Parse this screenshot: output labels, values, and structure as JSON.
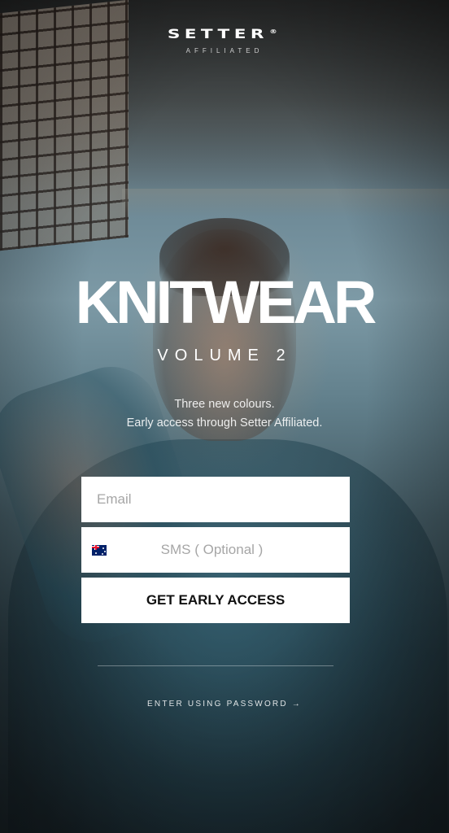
{
  "brand": {
    "name": "SETTER",
    "registered_mark": "®",
    "subtitle": "AFFILIATED"
  },
  "hero": {
    "headline": "KNITWEAR",
    "volume": "VOLUME 2",
    "description_line1": "Three new colours.",
    "description_line2": "Early access through Setter Affiliated."
  },
  "form": {
    "email_placeholder": "Email",
    "sms_placeholder": "SMS ( Optional )",
    "country_flag_icon": "australia-flag-icon",
    "submit_label": "GET EARLY ACCESS"
  },
  "footer": {
    "password_link": "ENTER USING PASSWORD →"
  },
  "colors": {
    "input_background": "#ffffff",
    "button_text": "#111111",
    "placeholder_text": "#a6a6a6"
  }
}
